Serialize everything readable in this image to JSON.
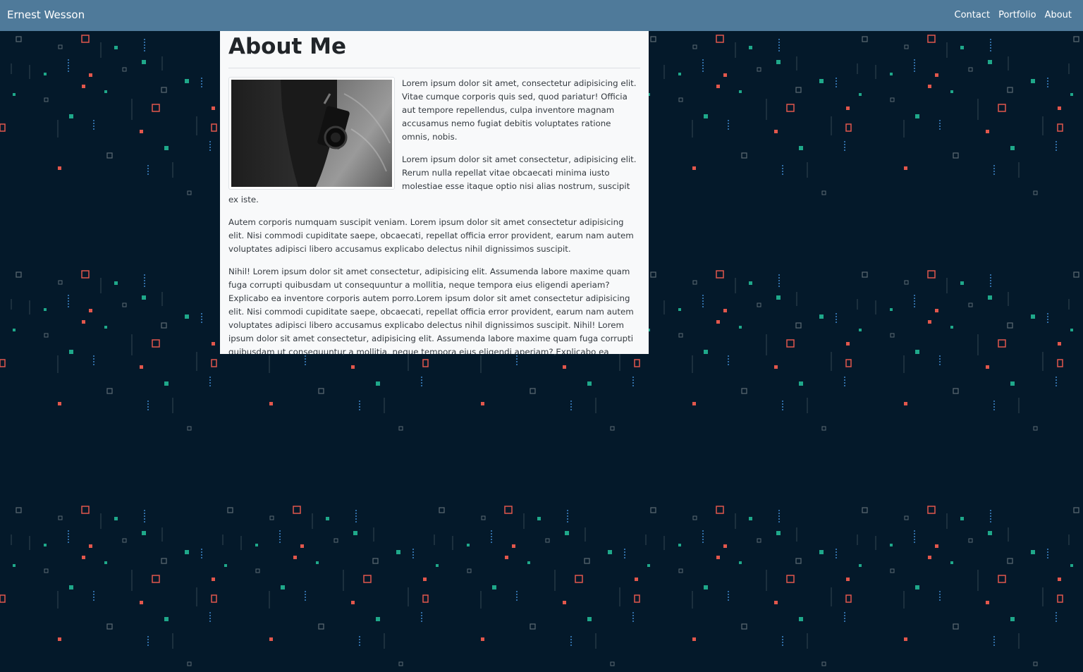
{
  "nav": {
    "brand": "Ernest Wesson",
    "links": [
      "Contact",
      "Portfolio",
      "About"
    ]
  },
  "about": {
    "heading": "About Me",
    "image_alt": "Person holding a camera, black and white photo",
    "paragraphs": [
      "Lorem ipsum dolor sit amet, consectetur adipisicing elit. Vitae cumque corporis quis sed, quod pariatur! Officia aut tempore repellendus, culpa inventore magnam accusamus nemo fugiat debitis voluptates ratione omnis, nobis.",
      "Lorem ipsum dolor sit amet consectetur, adipisicing elit. Rerum nulla repellat vitae obcaecati minima iusto molestiae esse itaque optio nisi alias nostrum, suscipit ex iste.",
      "Autem corporis numquam suscipit veniam. Lorem ipsum dolor sit amet consectetur adipisicing elit. Nisi commodi cupiditate saepe, obcaecati, repellat officia error provident, earum nam autem voluptates adipisci libero accusamus explicabo delectus nihil dignissimos suscipit.",
      "Nihil! Lorem ipsum dolor sit amet consectetur, adipisicing elit. Assumenda labore maxime quam fuga corrupti quibusdam ut consequuntur a mollitia, neque tempora eius eligendi aperiam? Explicabo ea inventore corporis autem porro.Lorem ipsum dolor sit amet consectetur adipisicing elit. Nisi commodi cupiditate saepe, obcaecati, repellat officia error provident, earum nam autem voluptates adipisci libero accusamus explicabo delectus nihil dignissimos suscipit. Nihil! Lorem ipsum dolor sit amet consectetur, adipisicing elit. Assumenda labore maxime quam fuga corrupti quibusdam ut consequuntur a mollitia, neque tempora eius eligendi aperiam? Explicabo ea inventore corporis autem porro."
    ]
  },
  "theme": {
    "navbar_bg": "#4f7a9a",
    "page_bg": "#04192a",
    "card_bg": "#f8f9fa",
    "accent_red": "#e2574c",
    "accent_teal": "#1fa88a",
    "accent_blue": "#3b82c4",
    "pattern_gray": "#5d6b74"
  }
}
